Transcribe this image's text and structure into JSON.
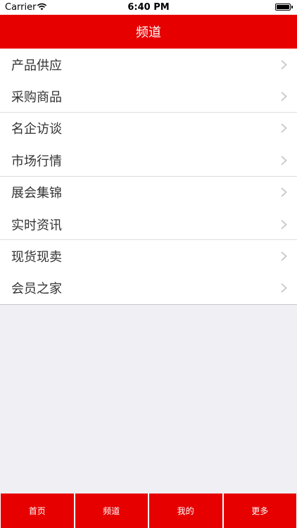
{
  "status_bar": {
    "carrier": "Carrier",
    "time": "6:40 PM"
  },
  "nav": {
    "title": "频道"
  },
  "channels": [
    {
      "label": "产品供应"
    },
    {
      "label": "采购商品"
    },
    {
      "label": "名企访谈"
    },
    {
      "label": "市场行情"
    },
    {
      "label": "展会集锦"
    },
    {
      "label": "实时资讯"
    },
    {
      "label": "现货现卖"
    },
    {
      "label": "会员之家"
    }
  ],
  "tabs": [
    {
      "label": "首页"
    },
    {
      "label": "频道"
    },
    {
      "label": "我的"
    },
    {
      "label": "更多"
    }
  ],
  "colors": {
    "brand_red": "#e60000",
    "background": "#efeff4",
    "text": "#333333",
    "chevron": "#c7c7cc"
  },
  "icons": {
    "wifi": "wifi-icon",
    "battery": "battery-icon",
    "chevron": "chevron-right-icon"
  }
}
